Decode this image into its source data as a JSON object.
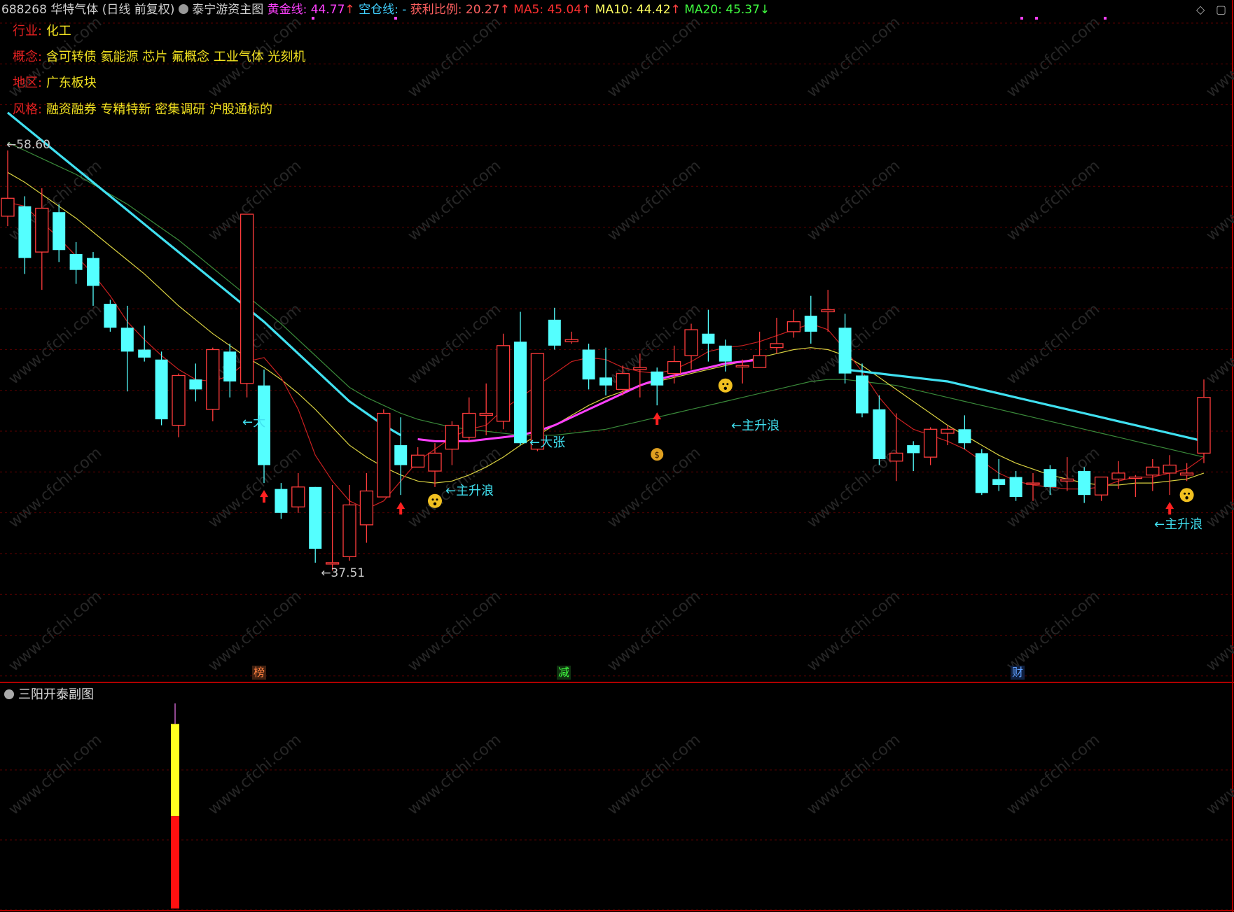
{
  "header": {
    "stock_code": "688268",
    "stock_name": "华特气体",
    "period": "(日线 前复权)",
    "indicator_name": "泰宁游资主图",
    "gold_line_label": "黄金线: 44.77",
    "empty_line_label": "空仓线: -",
    "profit_ratio_label": "获利比例: 20.27",
    "ma5_label": "MA5: 45.04",
    "ma10_label": "MA10: 44.42",
    "ma20_label": "MA20: 45.37",
    "up_arrow": "↑",
    "down_arrow": "↓"
  },
  "info": {
    "industry_key": "行业:",
    "industry_val": "化工",
    "concept_key": "概念:",
    "concept_val": "含可转债 氦能源 芯片 氟概念 工业气体 光刻机",
    "region_key": "地区:",
    "region_val": "广东板块",
    "style_key": "风格:",
    "style_val": "融资融券 专精特新 密集调研 沪股通标的"
  },
  "labels": {
    "high_price": "←58.60",
    "low_price": "←37.51",
    "da_zhang": "←大张",
    "da_zhang_partial": "←大",
    "zhu_sheng_lang": "←主升浪"
  },
  "bottom_tags": {
    "bang": "榜",
    "jian": "减",
    "cai": "财"
  },
  "subchart": {
    "title": "三阳开泰副图"
  },
  "watermark": "www.cfchi.com",
  "colors": {
    "up": "#ff3c3c",
    "down": "#54ffff",
    "ma5": "#d0d0d0",
    "ma10": "#ffff40",
    "ma20": "#40ff40",
    "gold": "#ffff40",
    "magenta": "#ff40ff",
    "cyan_line": "#40e0f0"
  },
  "chart_data": {
    "type": "candlestick",
    "price_range": [
      37.51,
      58.6
    ],
    "candles": [
      [
        55.3,
        56.2,
        58.6,
        54.8
      ],
      [
        55.8,
        53.2,
        56.3,
        52.4
      ],
      [
        53.5,
        55.7,
        56.7,
        51.6
      ],
      [
        55.5,
        53.6,
        55.9,
        53.0
      ],
      [
        53.4,
        52.6,
        54.0,
        51.9
      ],
      [
        53.2,
        51.8,
        53.5,
        50.8
      ],
      [
        50.9,
        49.7,
        51.1,
        49.5
      ],
      [
        49.7,
        48.5,
        50.8,
        46.5
      ],
      [
        48.6,
        48.2,
        49.8,
        48.0
      ],
      [
        48.1,
        45.1,
        48.5,
        44.8
      ],
      [
        44.8,
        47.3,
        47.4,
        44.2
      ],
      [
        47.1,
        46.6,
        47.9,
        46.0
      ],
      [
        45.6,
        48.6,
        48.7,
        45.0
      ],
      [
        48.5,
        47.0,
        48.9,
        46.2
      ],
      [
        46.9,
        55.4,
        55.4,
        46.2
      ],
      [
        46.8,
        42.8,
        47.6,
        41.9
      ],
      [
        41.6,
        40.4,
        41.9,
        40.1
      ],
      [
        40.7,
        41.7,
        42.4,
        40.4
      ],
      [
        41.7,
        38.6,
        41.7,
        37.9
      ],
      [
        37.9,
        37.9,
        41.8,
        37.5
      ],
      [
        38.2,
        40.8,
        41.8,
        38.0
      ],
      [
        39.8,
        41.5,
        42.4,
        38.9
      ],
      [
        41.2,
        45.4,
        45.6,
        41.2
      ],
      [
        43.8,
        42.8,
        45.2,
        41.3
      ],
      [
        42.7,
        43.3,
        43.7,
        42.7
      ],
      [
        42.5,
        43.4,
        43.9,
        41.7
      ],
      [
        43.6,
        44.8,
        45.0,
        42.8
      ],
      [
        44.2,
        45.4,
        46.2,
        44.0
      ],
      [
        45.3,
        45.4,
        46.9,
        44.3
      ],
      [
        45.0,
        48.8,
        49.4,
        44.6
      ],
      [
        49.0,
        43.9,
        50.5,
        43.8
      ],
      [
        43.6,
        48.4,
        48.4,
        43.5
      ],
      [
        50.1,
        48.8,
        50.7,
        48.6
      ],
      [
        49.0,
        49.1,
        49.5,
        48.9
      ],
      [
        48.6,
        47.1,
        48.9,
        46.6
      ],
      [
        47.2,
        46.8,
        48.7,
        46.3
      ],
      [
        46.6,
        47.4,
        47.8,
        46.3
      ],
      [
        47.6,
        47.7,
        48.4,
        46.2
      ],
      [
        47.5,
        46.8,
        47.7,
        45.8
      ],
      [
        47.4,
        48.0,
        48.8,
        46.9
      ],
      [
        48.3,
        49.6,
        49.9,
        47.6
      ],
      [
        49.4,
        48.9,
        50.6,
        48.0
      ],
      [
        48.8,
        48.0,
        49.1,
        47.5
      ],
      [
        47.8,
        47.8,
        48.1,
        46.9
      ],
      [
        47.7,
        48.3,
        49.5,
        47.7
      ],
      [
        48.7,
        48.9,
        50.2,
        48.4
      ],
      [
        49.5,
        50.0,
        50.6,
        49.2
      ],
      [
        50.3,
        49.5,
        51.3,
        48.9
      ],
      [
        50.5,
        50.6,
        51.6,
        49.5
      ],
      [
        49.7,
        47.4,
        50.4,
        46.9
      ],
      [
        47.3,
        45.4,
        47.9,
        45.2
      ],
      [
        45.6,
        43.1,
        46.3,
        42.8
      ],
      [
        43.0,
        43.4,
        45.4,
        42.0
      ],
      [
        43.8,
        43.4,
        44.0,
        42.5
      ],
      [
        43.2,
        44.6,
        44.7,
        42.8
      ],
      [
        44.4,
        44.6,
        44.8,
        43.8
      ],
      [
        44.6,
        43.9,
        45.3,
        43.6
      ],
      [
        43.4,
        41.4,
        43.6,
        41.3
      ],
      [
        42.1,
        41.8,
        43.1,
        41.5
      ],
      [
        42.2,
        41.2,
        42.5,
        41.0
      ],
      [
        41.9,
        41.9,
        42.4,
        41.0
      ],
      [
        42.6,
        41.7,
        42.8,
        41.3
      ],
      [
        42.0,
        42.1,
        43.2,
        41.5
      ],
      [
        42.5,
        41.3,
        42.7,
        40.9
      ],
      [
        41.3,
        42.2,
        42.2,
        41.0
      ],
      [
        42.1,
        42.4,
        43.0,
        41.6
      ],
      [
        42.2,
        42.2,
        42.3,
        41.2
      ],
      [
        42.3,
        42.7,
        43.1,
        41.5
      ],
      [
        42.4,
        42.8,
        43.3,
        41.3
      ],
      [
        42.3,
        42.4,
        42.9,
        42.0
      ],
      [
        43.4,
        46.2,
        47.1,
        42.9
      ]
    ],
    "ma5": [
      56.0,
      55.8,
      55.0,
      54.2,
      53.3,
      52.4,
      51.3,
      50.0,
      49.1,
      48.3,
      47.6,
      47.1,
      47.0,
      47.3,
      48.0,
      48.2,
      47.2,
      45.6,
      43.3,
      42.0,
      41.0,
      40.6,
      41.0,
      42.0,
      43.0,
      43.6,
      44.2,
      44.6,
      44.8,
      45.6,
      46.2,
      46.8,
      47.4,
      48.0,
      48.2,
      48.1,
      47.7,
      47.5,
      47.4,
      47.6,
      48.0,
      48.5,
      48.7,
      48.8,
      49.0,
      49.3,
      49.6,
      49.9,
      49.6,
      48.6,
      47.5,
      46.2,
      45.2,
      44.6,
      44.3,
      44.0,
      43.6,
      43.0,
      42.4,
      42.0,
      41.8,
      41.7,
      41.6,
      41.6,
      41.7,
      42.0,
      42.2,
      42.2,
      42.4,
      42.6,
      43.2
    ],
    "ma10": [
      57.5,
      57.0,
      56.4,
      55.8,
      55.2,
      54.5,
      53.8,
      53.1,
      52.4,
      51.6,
      50.8,
      50.1,
      49.4,
      48.8,
      48.2,
      47.7,
      47.1,
      46.4,
      45.6,
      44.7,
      43.8,
      43.2,
      42.7,
      42.3,
      42.0,
      41.9,
      42.0,
      42.3,
      42.7,
      43.2,
      43.8,
      44.3,
      44.8,
      45.3,
      45.8,
      46.2,
      46.5,
      46.8,
      47.0,
      47.2,
      47.4,
      47.6,
      47.8,
      48.0,
      48.2,
      48.4,
      48.6,
      48.7,
      48.6,
      48.3,
      47.8,
      47.2,
      46.6,
      46.0,
      45.4,
      44.8,
      44.3,
      43.8,
      43.3,
      42.9,
      42.6,
      42.3,
      42.1,
      41.9,
      41.8,
      41.8,
      41.9,
      41.9,
      42.0,
      42.1,
      42.4
    ],
    "ma20": [
      59.0,
      58.6,
      58.2,
      57.8,
      57.4,
      56.9,
      56.4,
      55.9,
      55.3,
      54.7,
      54.1,
      53.4,
      52.7,
      52.0,
      51.3,
      50.6,
      49.9,
      49.1,
      48.3,
      47.5,
      46.7,
      46.2,
      45.8,
      45.4,
      45.1,
      44.9,
      44.7,
      44.6,
      44.5,
      44.4,
      44.3,
      44.3,
      44.3,
      44.4,
      44.5,
      44.6,
      44.8,
      45.0,
      45.2,
      45.4,
      45.6,
      45.8,
      46.0,
      46.2,
      46.4,
      46.6,
      46.8,
      47.0,
      47.1,
      47.1,
      47.0,
      46.9,
      46.8,
      46.6,
      46.4,
      46.2,
      46.0,
      45.8,
      45.6,
      45.4,
      45.2,
      45.0,
      44.8,
      44.6,
      44.4,
      44.2,
      44.0,
      43.8,
      43.6,
      43.4,
      43.2
    ],
    "cyan_line": [
      60.5,
      59.8,
      59.1,
      58.4,
      57.7,
      57.0,
      56.3,
      55.6,
      54.9,
      54.2,
      53.5,
      52.8,
      52.1,
      51.4,
      50.7,
      50.0,
      49.2,
      48.4,
      47.6,
      46.8,
      46.0,
      45.4,
      44.8,
      44.3
    ],
    "cyan_line2": [
      47.6,
      47.5,
      47.4,
      47.3,
      47.2,
      47.1,
      47.0,
      46.8,
      46.6,
      46.4,
      46.2,
      46.0,
      45.8,
      45.6,
      45.4,
      45.2,
      45.0,
      44.8,
      44.6,
      44.4,
      44.2,
      44.0
    ],
    "magenta_line": [
      44.1,
      44.0,
      44.0,
      44.0,
      44.1,
      44.2,
      44.3,
      44.5,
      44.8,
      45.2,
      45.6,
      46.0,
      46.4,
      46.8,
      47.1,
      47.3,
      47.5,
      47.7,
      47.9,
      48.0,
      48.1
    ],
    "up_arrows": [
      15,
      23,
      38,
      68
    ],
    "smile_face_idx": [
      25,
      42,
      69
    ],
    "money_bag_idx": 38,
    "subchart_bar": {
      "total": 1.0,
      "yellow": 0.45,
      "red": 0.45
    }
  }
}
